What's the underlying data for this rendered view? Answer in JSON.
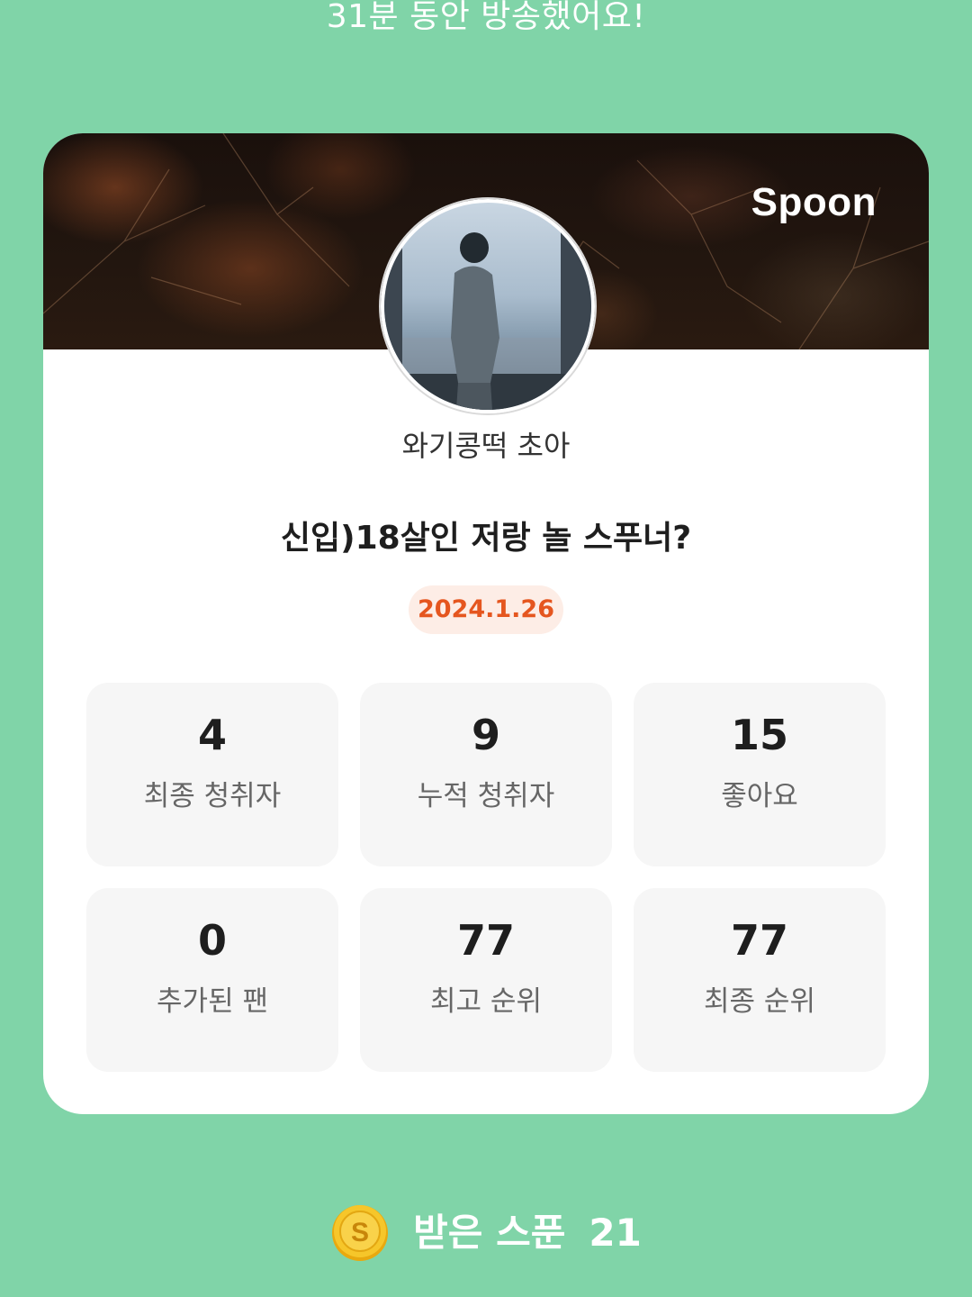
{
  "headline": "31분 동안 방송했어요!",
  "card": {
    "brand": "Spoon",
    "username": "와기콩떡 초아",
    "title": "신입)18살인 저랑 놀 스푸너?",
    "date": "2024.1.26"
  },
  "stats": [
    {
      "value": "4",
      "label": "최종 청취자"
    },
    {
      "value": "9",
      "label": "누적 청취자"
    },
    {
      "value": "15",
      "label": "좋아요"
    },
    {
      "value": "0",
      "label": "추가된 팬"
    },
    {
      "value": "77",
      "label": "최고 순위"
    },
    {
      "value": "77",
      "label": "최종 순위"
    }
  ],
  "spoons": {
    "icon": "spoon-coin-icon",
    "coin_letter": "S",
    "label": "받은 스푼",
    "count": "21"
  },
  "colors": {
    "background": "#80D4A8",
    "date_text": "#E5561F",
    "date_bg": "#FDEDE6",
    "coin": "#F3C21E"
  }
}
